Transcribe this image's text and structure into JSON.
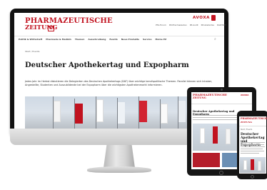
{
  "brand": {
    "logo_line1": "PHARMAZEUTISCHE",
    "logo_line2": "ZEITUNG",
    "logo_badge": "PZ",
    "publisher": "AVOXA",
    "accent_color": "#c1121f"
  },
  "header": {
    "top_links": [
      "PTA-Forum",
      "PZ-Pharmazeuten",
      "PZ-Audit",
      "PZ-Akademie",
      "DAZ/SMY"
    ]
  },
  "nav": {
    "items": [
      "Politik & Wirtschaft",
      "Pharmazie & Medizin",
      "Themen",
      "Ausschreibung",
      "Events",
      "Neue Produkte",
      "Service",
      "Meine PZ"
    ],
    "search_icon": "search-icon"
  },
  "article": {
    "breadcrumb": "Start / Events",
    "title": "Deutscher Apothekertag und Expopharm",
    "body": "Jedes Jahr im Herbst diskutieren die Delegierten des Deutschen Apothekertags (DAT) über wichtige berufspolitische Themen. Parallel können sich Inhaber, Angestellte, Studenten und Auszubildende bei der Expopharm über die wichtigsten Apothekenmarkt informieren."
  },
  "tablet": {
    "title": "Deutscher Apothekertag und Expopharm"
  },
  "phone": {
    "breadcrumb": "Start / Events",
    "title": "Deutscher Apothekertag und Expopharm"
  }
}
